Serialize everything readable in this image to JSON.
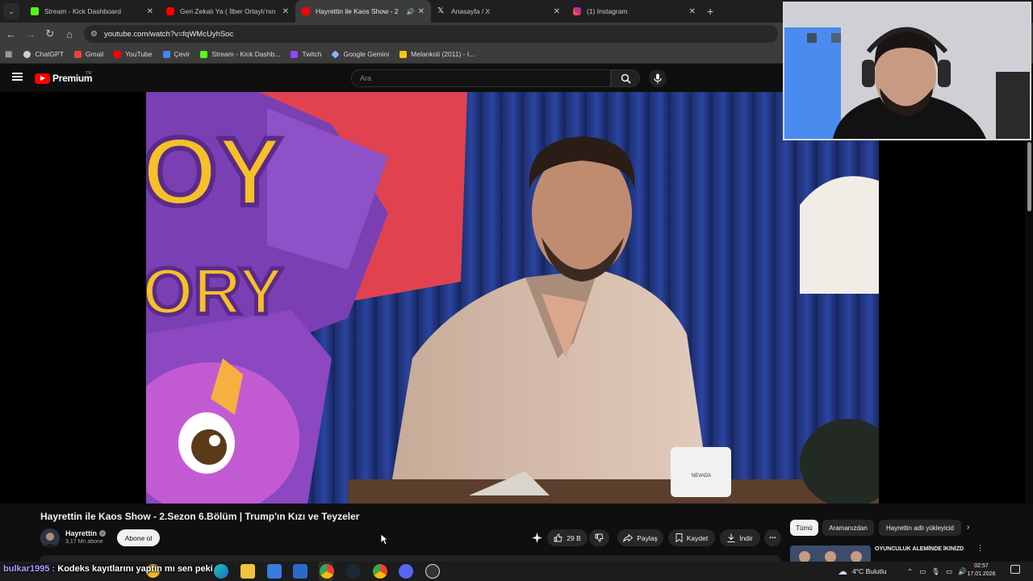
{
  "browser": {
    "tabs": [
      {
        "title": "Stream - Kick Dashboard",
        "favicon_color": "#53fc18",
        "active": false
      },
      {
        "title": "Geri Zekalı Ya ( İlber Ortaylı'nın",
        "favicon_color": "#ff0000",
        "active": false
      },
      {
        "title": "Hayrettin ile Kaos Show - 2",
        "favicon_color": "#ff0000",
        "active": true,
        "audio": true
      },
      {
        "title": "Anasayfa / X",
        "favicon_color": "#ffffff",
        "active": false
      },
      {
        "title": "(1) Instagram",
        "favicon_color": "#e1306c",
        "active": false
      }
    ],
    "address": "youtube.com/watch?v=fqWMcUyhSoc",
    "bookmarks": [
      {
        "label": "ChatGPT",
        "color": "#cfcfcf"
      },
      {
        "label": "Gmail",
        "color": "#ea4335"
      },
      {
        "label": "YouTube",
        "color": "#ff0000"
      },
      {
        "label": "Çevir",
        "color": "#4285f4"
      },
      {
        "label": "Stream - Kick Dashb...",
        "color": "#53fc18"
      },
      {
        "label": "Twitch",
        "color": "#9146ff"
      },
      {
        "label": "Google Gemini",
        "color": "#8ab4f8"
      },
      {
        "label": "Melankoli (2011) - I...",
        "color": "#f5c518"
      }
    ]
  },
  "youtube": {
    "logo": "Premium",
    "country": "TR",
    "search_placeholder": "Ara",
    "video": {
      "title": "Hayrettin ile Kaos Show - 2.Sezon 6.Bölüm | Trump'ın Kızı ve Teyzeler",
      "channel": "Hayrettin",
      "subscribers": "3,17 Mn abone",
      "subscribe_label": "Abone ol",
      "likes": "29 B",
      "share_label": "Paylaş",
      "save_label": "Kaydet",
      "download_label": "İndir",
      "poster_text_1": "OY",
      "poster_text_2": "ORY",
      "mug_text": "NEVADA"
    },
    "chips": [
      "Tümü",
      "Aramanızdan",
      "Hayrettin adlı yükleyicid"
    ],
    "recommendation": {
      "title": "OYUNCULUK ALEMİNDE İKİNİZDEN DE ESKİYİMDİR!"
    }
  },
  "overlay_chat": {
    "user": "bulkar1995 :",
    "message": "Kodeks kayıtlarını yaptın mı sen peki"
  },
  "taskbar": {
    "weather": "4°C  Bulutlu",
    "time": "02:57",
    "date": "17.01.2026"
  }
}
